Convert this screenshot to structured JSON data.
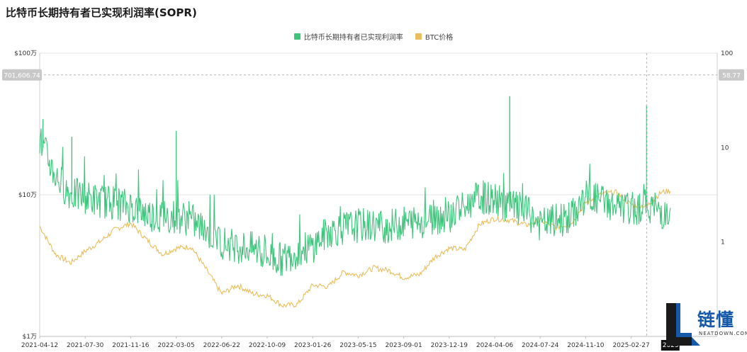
{
  "chart_data": {
    "type": "line",
    "title": "比特币长期持有者已实现利润率(SOPR)",
    "x_ticks": [
      "2021-04-12",
      "2021-07-30",
      "2021-11-16",
      "2022-03-05",
      "2022-06-22",
      "2022-10-09",
      "2023-01-26",
      "2023-05-15",
      "2023-09-01",
      "2023-12-19",
      "2024-04-06",
      "2024-07-24",
      "2024-11-10",
      "2025-02-27"
    ],
    "x_tick_partial": "2025",
    "y_left": {
      "label": "",
      "scale": "log",
      "ticks": [
        "$1万",
        "$10万",
        "$100万"
      ],
      "range": [
        10000,
        1000000
      ]
    },
    "y_right": {
      "label": "",
      "scale": "log",
      "ticks": [
        "1",
        "10",
        "100"
      ],
      "range": [
        0.1,
        100
      ]
    },
    "crosshair": {
      "date": "2025-04",
      "left_value": "701,606.74",
      "right_value": "58.77"
    },
    "series": [
      {
        "name": "比特币长期持有者已实现利润率",
        "axis": "right",
        "color": "#3fc57c",
        "x": [
          "2021-04-12",
          "2021-05-20",
          "2021-06-25",
          "2021-07-30",
          "2021-09-05",
          "2021-10-10",
          "2021-11-16",
          "2021-12-25",
          "2022-02-01",
          "2022-03-05",
          "2022-04-10",
          "2022-05-15",
          "2022-06-22",
          "2022-07-30",
          "2022-09-05",
          "2022-10-09",
          "2022-11-15",
          "2022-12-20",
          "2023-01-26",
          "2023-03-05",
          "2023-04-10",
          "2023-05-15",
          "2023-06-22",
          "2023-07-28",
          "2023-09-01",
          "2023-10-10",
          "2023-11-15",
          "2023-12-19",
          "2024-01-25",
          "2024-03-01",
          "2024-04-06",
          "2024-05-15",
          "2024-06-20",
          "2024-07-24",
          "2024-08-30",
          "2024-10-05",
          "2024-11-10",
          "2024-12-18",
          "2025-01-22",
          "2025-02-27",
          "2025-04-05",
          "2025-05-10",
          "2025-06-01"
        ],
        "values": [
          12.0,
          5.0,
          3.2,
          3.0,
          2.7,
          2.6,
          2.4,
          2.0,
          1.8,
          1.9,
          1.7,
          1.3,
          1.0,
          0.9,
          0.85,
          0.7,
          0.65,
          0.8,
          0.9,
          1.3,
          1.4,
          1.5,
          1.5,
          1.45,
          1.6,
          1.65,
          1.8,
          1.9,
          2.3,
          3.0,
          2.8,
          2.4,
          2.1,
          1.5,
          1.7,
          1.8,
          3.0,
          2.8,
          2.3,
          2.2,
          2.5,
          2.1,
          1.7
        ],
        "spikes": [
          {
            "x": "2021-04-20",
            "value": 20.0
          },
          {
            "x": "2021-06-28",
            "value": 13.0
          },
          {
            "x": "2022-03-05",
            "value": 15.0
          },
          {
            "x": "2024-05-12",
            "value": 35.0
          },
          {
            "x": "2025-04-05",
            "value": 28.0
          }
        ]
      },
      {
        "name": "BTC价格",
        "axis": "left",
        "color": "#e9be5d",
        "x": [
          "2021-04-12",
          "2021-05-20",
          "2021-06-25",
          "2021-07-30",
          "2021-09-05",
          "2021-10-10",
          "2021-11-16",
          "2021-12-25",
          "2022-02-01",
          "2022-03-05",
          "2022-04-10",
          "2022-05-15",
          "2022-06-22",
          "2022-07-30",
          "2022-09-05",
          "2022-10-09",
          "2022-11-15",
          "2022-12-20",
          "2023-01-26",
          "2023-03-05",
          "2023-04-10",
          "2023-05-15",
          "2023-06-22",
          "2023-07-28",
          "2023-09-01",
          "2023-10-10",
          "2023-11-15",
          "2023-12-19",
          "2024-01-25",
          "2024-03-01",
          "2024-04-06",
          "2024-05-15",
          "2024-06-20",
          "2024-07-24",
          "2024-08-30",
          "2024-10-05",
          "2024-11-10",
          "2024-12-18",
          "2025-01-22",
          "2025-02-27",
          "2025-04-05",
          "2025-05-10",
          "2025-06-01"
        ],
        "values": [
          60000,
          38000,
          33000,
          40000,
          47000,
          57000,
          63000,
          48000,
          38000,
          42000,
          43000,
          30000,
          20000,
          23000,
          20000,
          19500,
          16500,
          16800,
          23000,
          22500,
          28500,
          27000,
          30500,
          29300,
          26000,
          27500,
          36500,
          42000,
          41000,
          62000,
          68000,
          66000,
          61000,
          66000,
          59000,
          62000,
          88000,
          101000,
          104000,
          85000,
          83000,
          104000,
          107000
        ]
      }
    ]
  },
  "legend": [
    "比特币长期持有者已实现利润率",
    "BTC价格"
  ],
  "watermark": {
    "logo_text": "链懂",
    "sub_text": "NEATDOWN.COM"
  },
  "colors": {
    "sopr": "#3fc57c",
    "btc": "#e9be5d",
    "axis_text": "#333333",
    "grid": "#e6e6e6",
    "badge_bg": "#c8c8c8"
  }
}
